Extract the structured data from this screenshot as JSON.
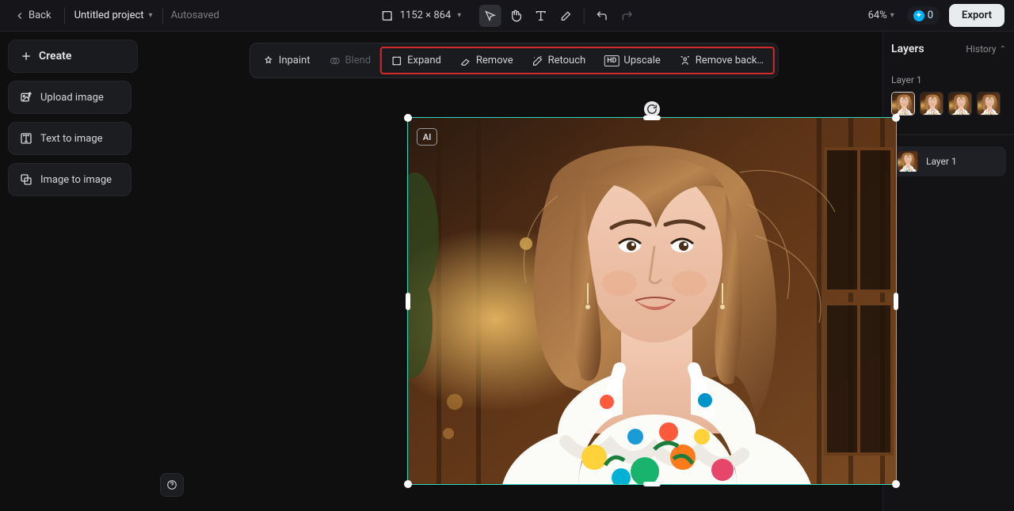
{
  "topbar": {
    "back": "Back",
    "project": "Untitled project",
    "status": "Autosaved",
    "canvas_size": "1152 × 864",
    "zoom": "64%",
    "credits": "0",
    "export": "Export"
  },
  "left": {
    "create": "Create",
    "upload": "Upload image",
    "text2img": "Text to image",
    "img2img": "Image to image"
  },
  "toolbar": {
    "inpaint": "Inpaint",
    "blend": "Blend",
    "expand": "Expand",
    "remove": "Remove",
    "retouch": "Retouch",
    "upscale": "Upscale",
    "remove_bg": "Remove back…"
  },
  "ai_badge": "AI",
  "right": {
    "title": "Layers",
    "history": "History",
    "group_label": "Layer 1",
    "layer_name": "Layer 1"
  }
}
